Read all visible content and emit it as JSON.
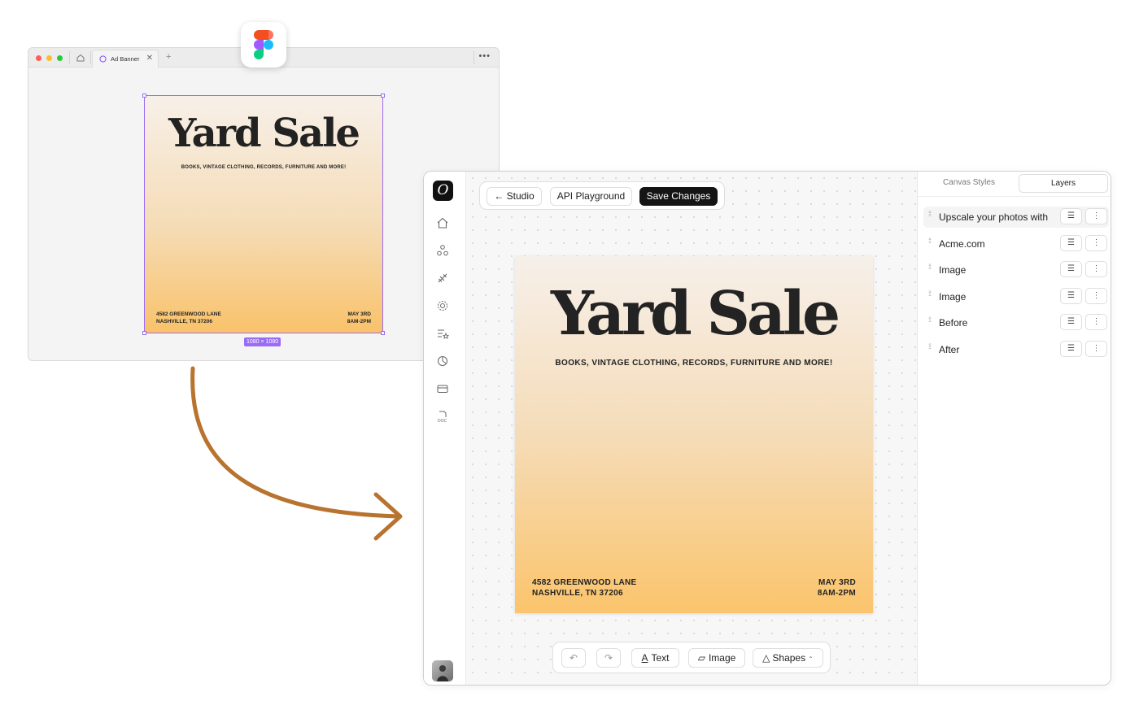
{
  "figma_window": {
    "tab_title": "Ad Banner",
    "tab_close": "✕",
    "new_tab": "+",
    "more": "•••",
    "size_badge": "1080 × 1080",
    "artboard": {
      "title": "Yard Sale",
      "subtitle": "BOOKS, VINTAGE CLOTHING, RECORDS, FURNITURE AND MORE!",
      "address_line1": "4582 GREENWOOD LANE",
      "address_line2": "NASHVILLE, TN 37206",
      "date_line1": "MAY 3RD",
      "date_line2": "8AM-2PM"
    },
    "traffic_lights": [
      "#ff5f57",
      "#febc2e",
      "#28c840"
    ]
  },
  "arrow_color": "#b8732f",
  "app": {
    "logo_letter": "O",
    "rail_icons": [
      "home-icon",
      "nodes-icon",
      "plugin-icon",
      "gear-icon",
      "list-star-icon",
      "chart-icon",
      "card-icon",
      "doc-icon"
    ],
    "topbar": {
      "studio_label": "← Studio",
      "api_label": "API Playground",
      "save_label": "Save Changes"
    },
    "banner": {
      "title": "Yard Sale",
      "subtitle": "BOOKS, VINTAGE CLOTHING, RECORDS, FURNITURE AND MORE!",
      "address_line1": "4582 GREENWOOD LANE",
      "address_line2": "NASHVILLE, TN 37206",
      "date_line1": "MAY 3RD",
      "date_line2": "8AM-2PM"
    },
    "bottombar": {
      "undo_icon": "↶",
      "redo_icon": "↷",
      "text_label": "Text",
      "image_label": "Image",
      "shapes_label": "Shapes"
    },
    "panel": {
      "tabs": [
        "Canvas Styles",
        "Layers"
      ],
      "active_tab": "Layers",
      "layers": [
        {
          "name": "Upscale your photos with"
        },
        {
          "name": "Acme.com"
        },
        {
          "name": "Image"
        },
        {
          "name": "Image"
        },
        {
          "name": "Before"
        },
        {
          "name": "After"
        }
      ]
    }
  }
}
